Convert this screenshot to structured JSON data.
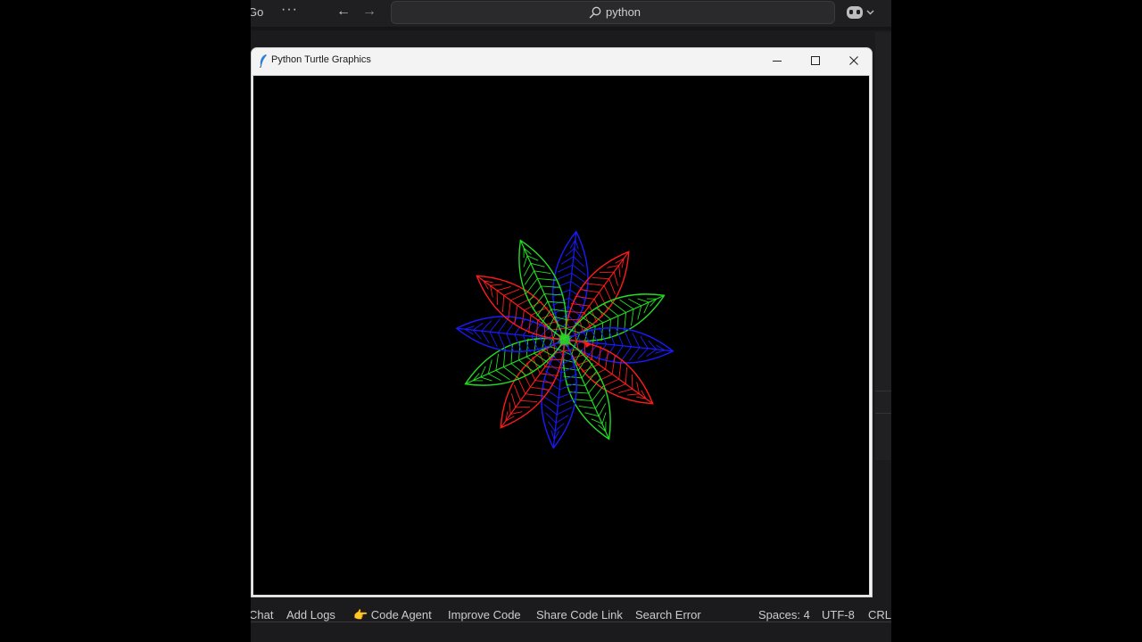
{
  "vscode": {
    "titlebar": {
      "go_menu": "Go",
      "more_label": "···",
      "back_glyph": "←",
      "forward_glyph": "→",
      "search_text": "python",
      "copilot_caret": "⌄"
    },
    "statusbar": {
      "items": [
        "Chat",
        "Add Logs",
        "👉 Code Agent",
        "Improve Code",
        "Share Code Link",
        "Search Error"
      ],
      "right_items": [
        "Spaces: 4",
        "UTF-8",
        "CRLF"
      ]
    }
  },
  "turtle_window": {
    "title": "Python Turtle Graphics",
    "canvas_background": "#000000",
    "controls": [
      "minimize-icon",
      "maximize-icon",
      "close-icon"
    ]
  },
  "drawing": {
    "petal_colors": [
      "#1a1aff",
      "#ff1a1a",
      "#22dd22"
    ],
    "petal_count": 12,
    "petal_angles_deg": [
      0,
      30,
      60,
      90,
      120,
      150,
      180,
      210,
      240,
      270,
      300,
      330
    ]
  },
  "colors": {
    "editor_bg": "#1b1b1d",
    "window_chrome": "#f3f3f3",
    "status_text": "#cccccc"
  }
}
